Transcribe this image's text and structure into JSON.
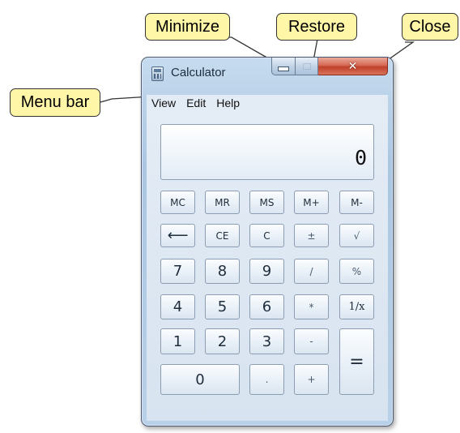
{
  "callouts": {
    "minimize": "Minimize",
    "restore": "Restore",
    "close": "Close",
    "menu_bar": "Menu bar"
  },
  "window": {
    "title": "Calculator",
    "title_icon": "calculator-icon",
    "controls": {
      "minimize": "minimize-icon",
      "restore": "restore-icon",
      "close": "close-icon"
    },
    "close_button_color": "#c8452f"
  },
  "menu": {
    "items": [
      "View",
      "Edit",
      "Help"
    ]
  },
  "display": {
    "value": "0"
  },
  "keypad": {
    "memory": [
      "MC",
      "MR",
      "MS",
      "M+",
      "M-"
    ],
    "edit": {
      "backspace": "⟵",
      "ce": "CE",
      "c": "C",
      "negate": "±",
      "sqrt": "√"
    },
    "row7": {
      "d7": "7",
      "d8": "8",
      "d9": "9",
      "divide": "/",
      "percent": "%"
    },
    "row4": {
      "d4": "4",
      "d5": "5",
      "d6": "6",
      "multiply": "*",
      "reciprocal": "1/x"
    },
    "row1": {
      "d1": "1",
      "d2": "2",
      "d3": "3",
      "subtract": "-",
      "equals": "="
    },
    "row0": {
      "d0": "0",
      "decimal": ".",
      "add": "+"
    }
  }
}
